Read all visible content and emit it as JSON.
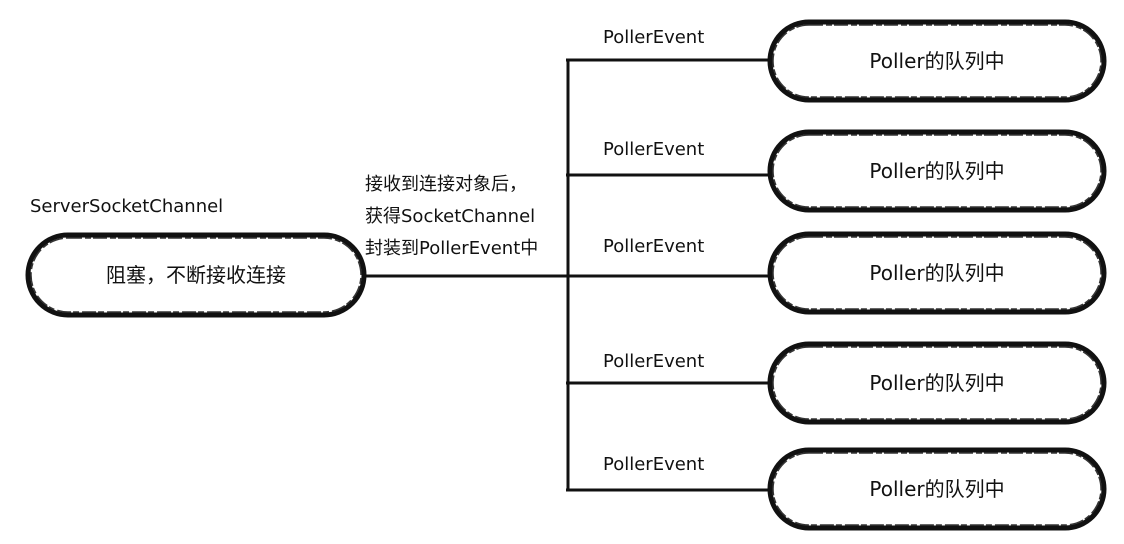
{
  "source": {
    "caption": "ServerSocketChannel",
    "label": "阻塞，不断接收连接"
  },
  "connector_note": {
    "lines": [
      "接收到连接对象后，",
      "获得SocketChannel",
      "封装到PollerEvent中"
    ]
  },
  "branches": [
    {
      "event_label": "PollerEvent",
      "target_label": "Poller的队列中"
    },
    {
      "event_label": "PollerEvent",
      "target_label": "Poller的队列中"
    },
    {
      "event_label": "PollerEvent",
      "target_label": "Poller的队列中"
    },
    {
      "event_label": "PollerEvent",
      "target_label": "Poller的队列中"
    },
    {
      "event_label": "PollerEvent",
      "target_label": "Poller的队列中"
    }
  ],
  "colors": {
    "stroke": "#111111",
    "node_fill": "#ffffff"
  }
}
